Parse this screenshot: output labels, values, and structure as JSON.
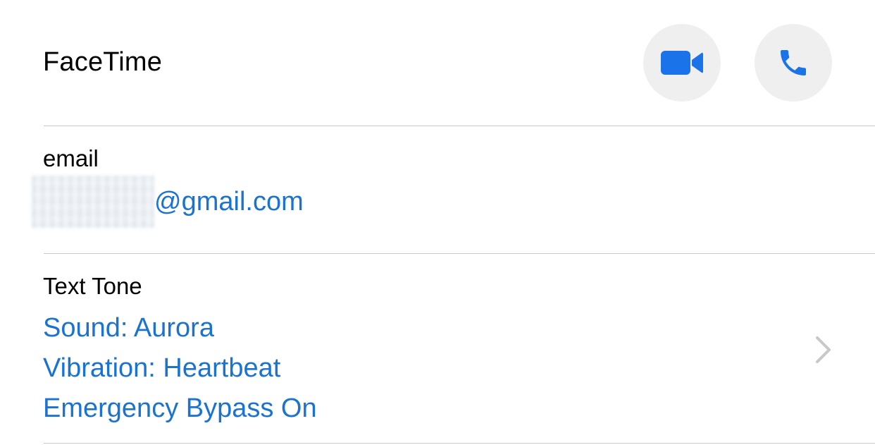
{
  "facetime": {
    "label": "FaceTime",
    "video_icon": "video-camera-icon",
    "audio_icon": "phone-icon"
  },
  "email": {
    "label": "email",
    "value_visible": "@gmail.com",
    "redacted": true
  },
  "text_tone": {
    "label": "Text Tone",
    "sound": "Sound: Aurora",
    "vibration": "Vibration: Heartbeat",
    "emergency_bypass": "Emergency Bypass On",
    "disclosure_icon": "chevron-right-icon"
  },
  "colors": {
    "accent": "#1a73d1",
    "button_bg": "#efeff0",
    "divider": "#c8c7cc",
    "chevron": "#c7c7cc",
    "icon_blue": "#1a73e8"
  }
}
